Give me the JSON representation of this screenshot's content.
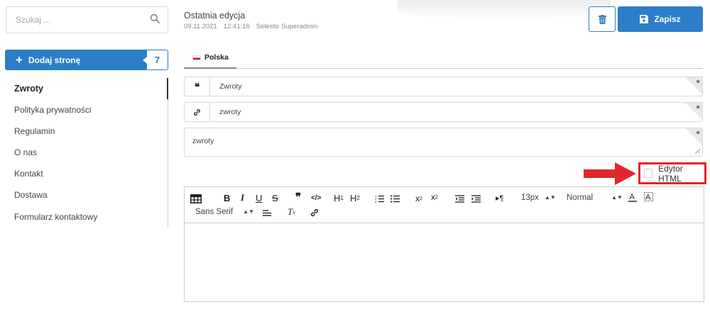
{
  "search": {
    "placeholder": "Szukaj ...",
    "icon": "search-icon"
  },
  "sidebar": {
    "add_label": "Dodaj stronę",
    "count": "7",
    "items": [
      {
        "label": "Zwroty",
        "active": true
      },
      {
        "label": "Polityka prywatności"
      },
      {
        "label": "Regulamin"
      },
      {
        "label": "O nas"
      },
      {
        "label": "Kontakt"
      },
      {
        "label": "Dostawa"
      },
      {
        "label": "Formularz kontaktowy"
      }
    ]
  },
  "header": {
    "title": "Ostatnia edycja",
    "date": "09.11.2021",
    "time": "12:41:16",
    "user": "Selesto Superadmin",
    "save_label": "Zapisz"
  },
  "tabs": [
    {
      "label": "Polska",
      "flag": "pl-flag"
    }
  ],
  "fields": {
    "title_value": "Zwroty",
    "slug_value": "zwroty",
    "description_value": "zwroty",
    "required_mark": "*"
  },
  "html_editor": {
    "label": "Edytor HTML",
    "checked": false
  },
  "editor_toolbar": {
    "font_size": "13px",
    "heading": "Normal",
    "font_family": "Sans Serif",
    "h1": "H",
    "h2": "H"
  },
  "colors": {
    "accent": "#2b7ec7",
    "highlight": "#e3262b"
  }
}
